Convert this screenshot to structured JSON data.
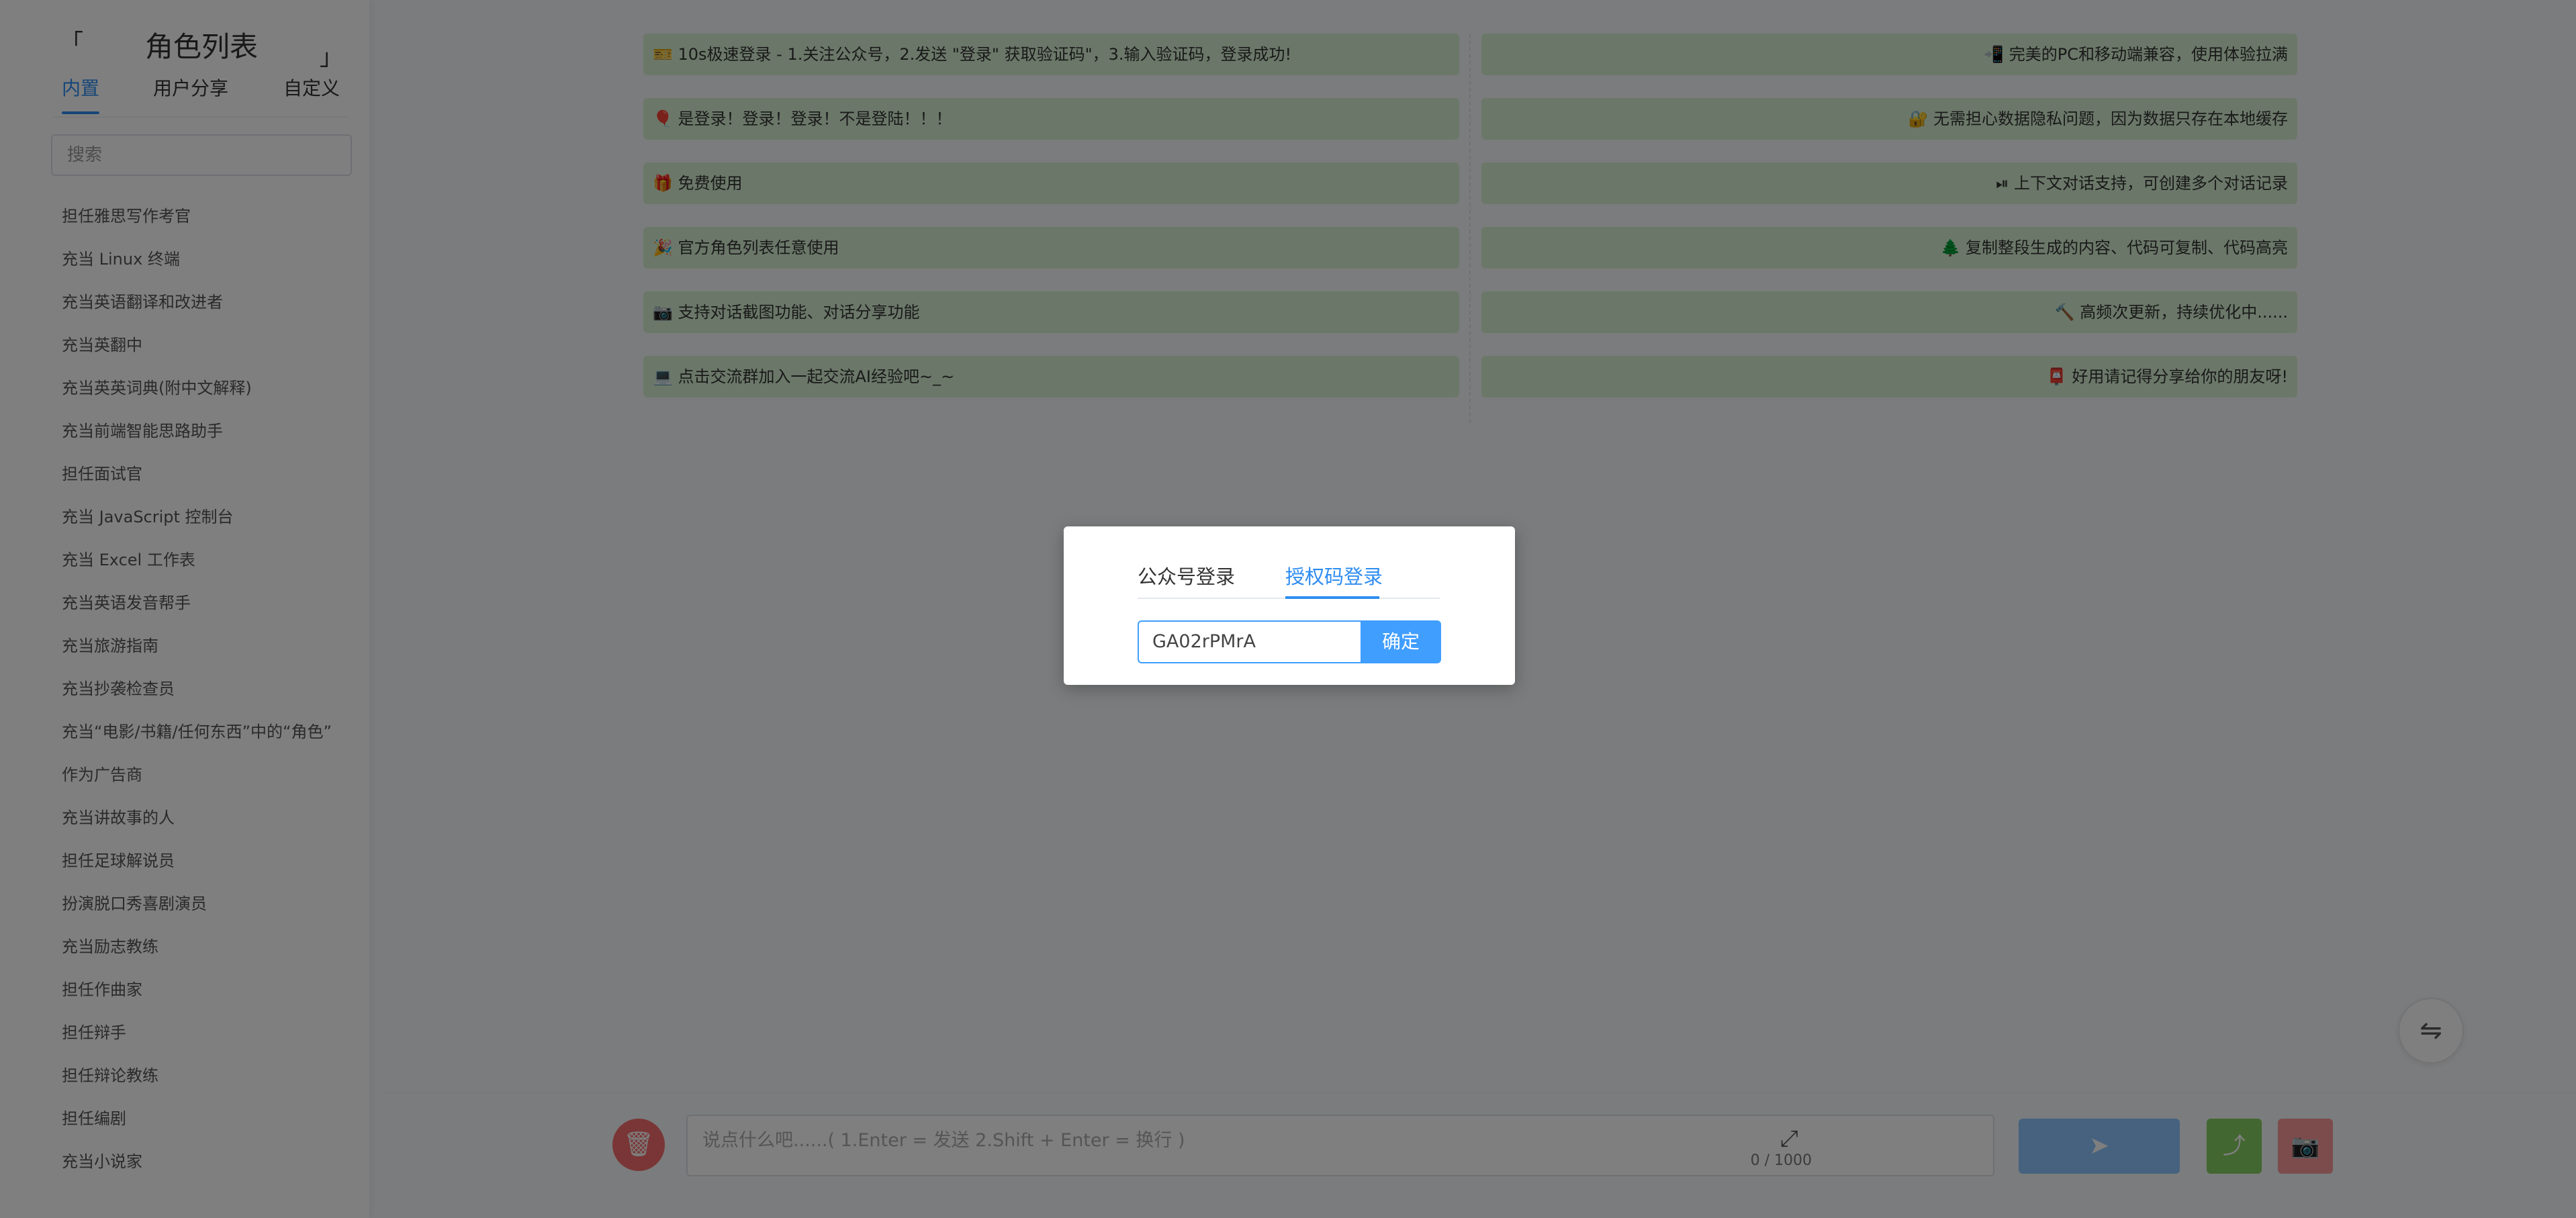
{
  "sidebar": {
    "bracket_left": "「",
    "bracket_right": "」",
    "title": "角色列表",
    "tabs": [
      "内置",
      "用户分享",
      "自定义"
    ],
    "search_placeholder": "搜索",
    "roles": [
      "担任雅思写作考官",
      "充当 Linux 终端",
      "充当英语翻译和改进者",
      "充当英翻中",
      "充当英英词典(附中文解释)",
      "充当前端智能思路助手",
      "担任面试官",
      "充当 JavaScript 控制台",
      "充当 Excel 工作表",
      "充当英语发音帮手",
      "充当旅游指南",
      "充当抄袭检查员",
      "充当“电影/书籍/任何东西”中的“角色”",
      "作为广告商",
      "充当讲故事的人",
      "担任足球解说员",
      "扮演脱口秀喜剧演员",
      "充当励志教练",
      "担任作曲家",
      "担任辩手",
      "担任辩论教练",
      "担任编剧",
      "充当小说家"
    ]
  },
  "features_left": [
    "🎫 10s极速登录 - 1.关注公众号，2.发送 \"登录\" 获取验证码\"，3.输入验证码，登录成功!",
    "🎈 是登录！登录！登录！不是登陆！！！",
    "🎁 免费使用",
    "🎉 官方角色列表任意使用",
    "📷 支持对话截图功能、对话分享功能",
    "💻 点击交流群加入一起交流AI经验吧~_~"
  ],
  "features_right": [
    "📲 完美的PC和移动端兼容，使用体验拉满",
    "🔐 无需担心数据隐私问题，因为数据只存在本地缓存",
    "⏯ 上下文对话支持，可创建多个对话记录",
    "🌲 复制整段生成的内容、代码可复制、代码高亮",
    "🔨 高频次更新，持续优化中......",
    "📮 好用请记得分享给你的朋友呀!"
  ],
  "input": {
    "placeholder": "说点什么吧......( 1.Enter = 发送   2.Shift + Enter = 换行 )",
    "counter": "0 / 1000"
  },
  "icons": {
    "switch": "⇋",
    "trash": "🗑",
    "expand": "⤢",
    "send": "➤",
    "share": "⤴",
    "camera": "📷"
  },
  "modal": {
    "tab_wechat": "公众号登录",
    "tab_code": "授权码登录",
    "code_value": "GA02rPMrA",
    "confirm_label": "确定"
  }
}
